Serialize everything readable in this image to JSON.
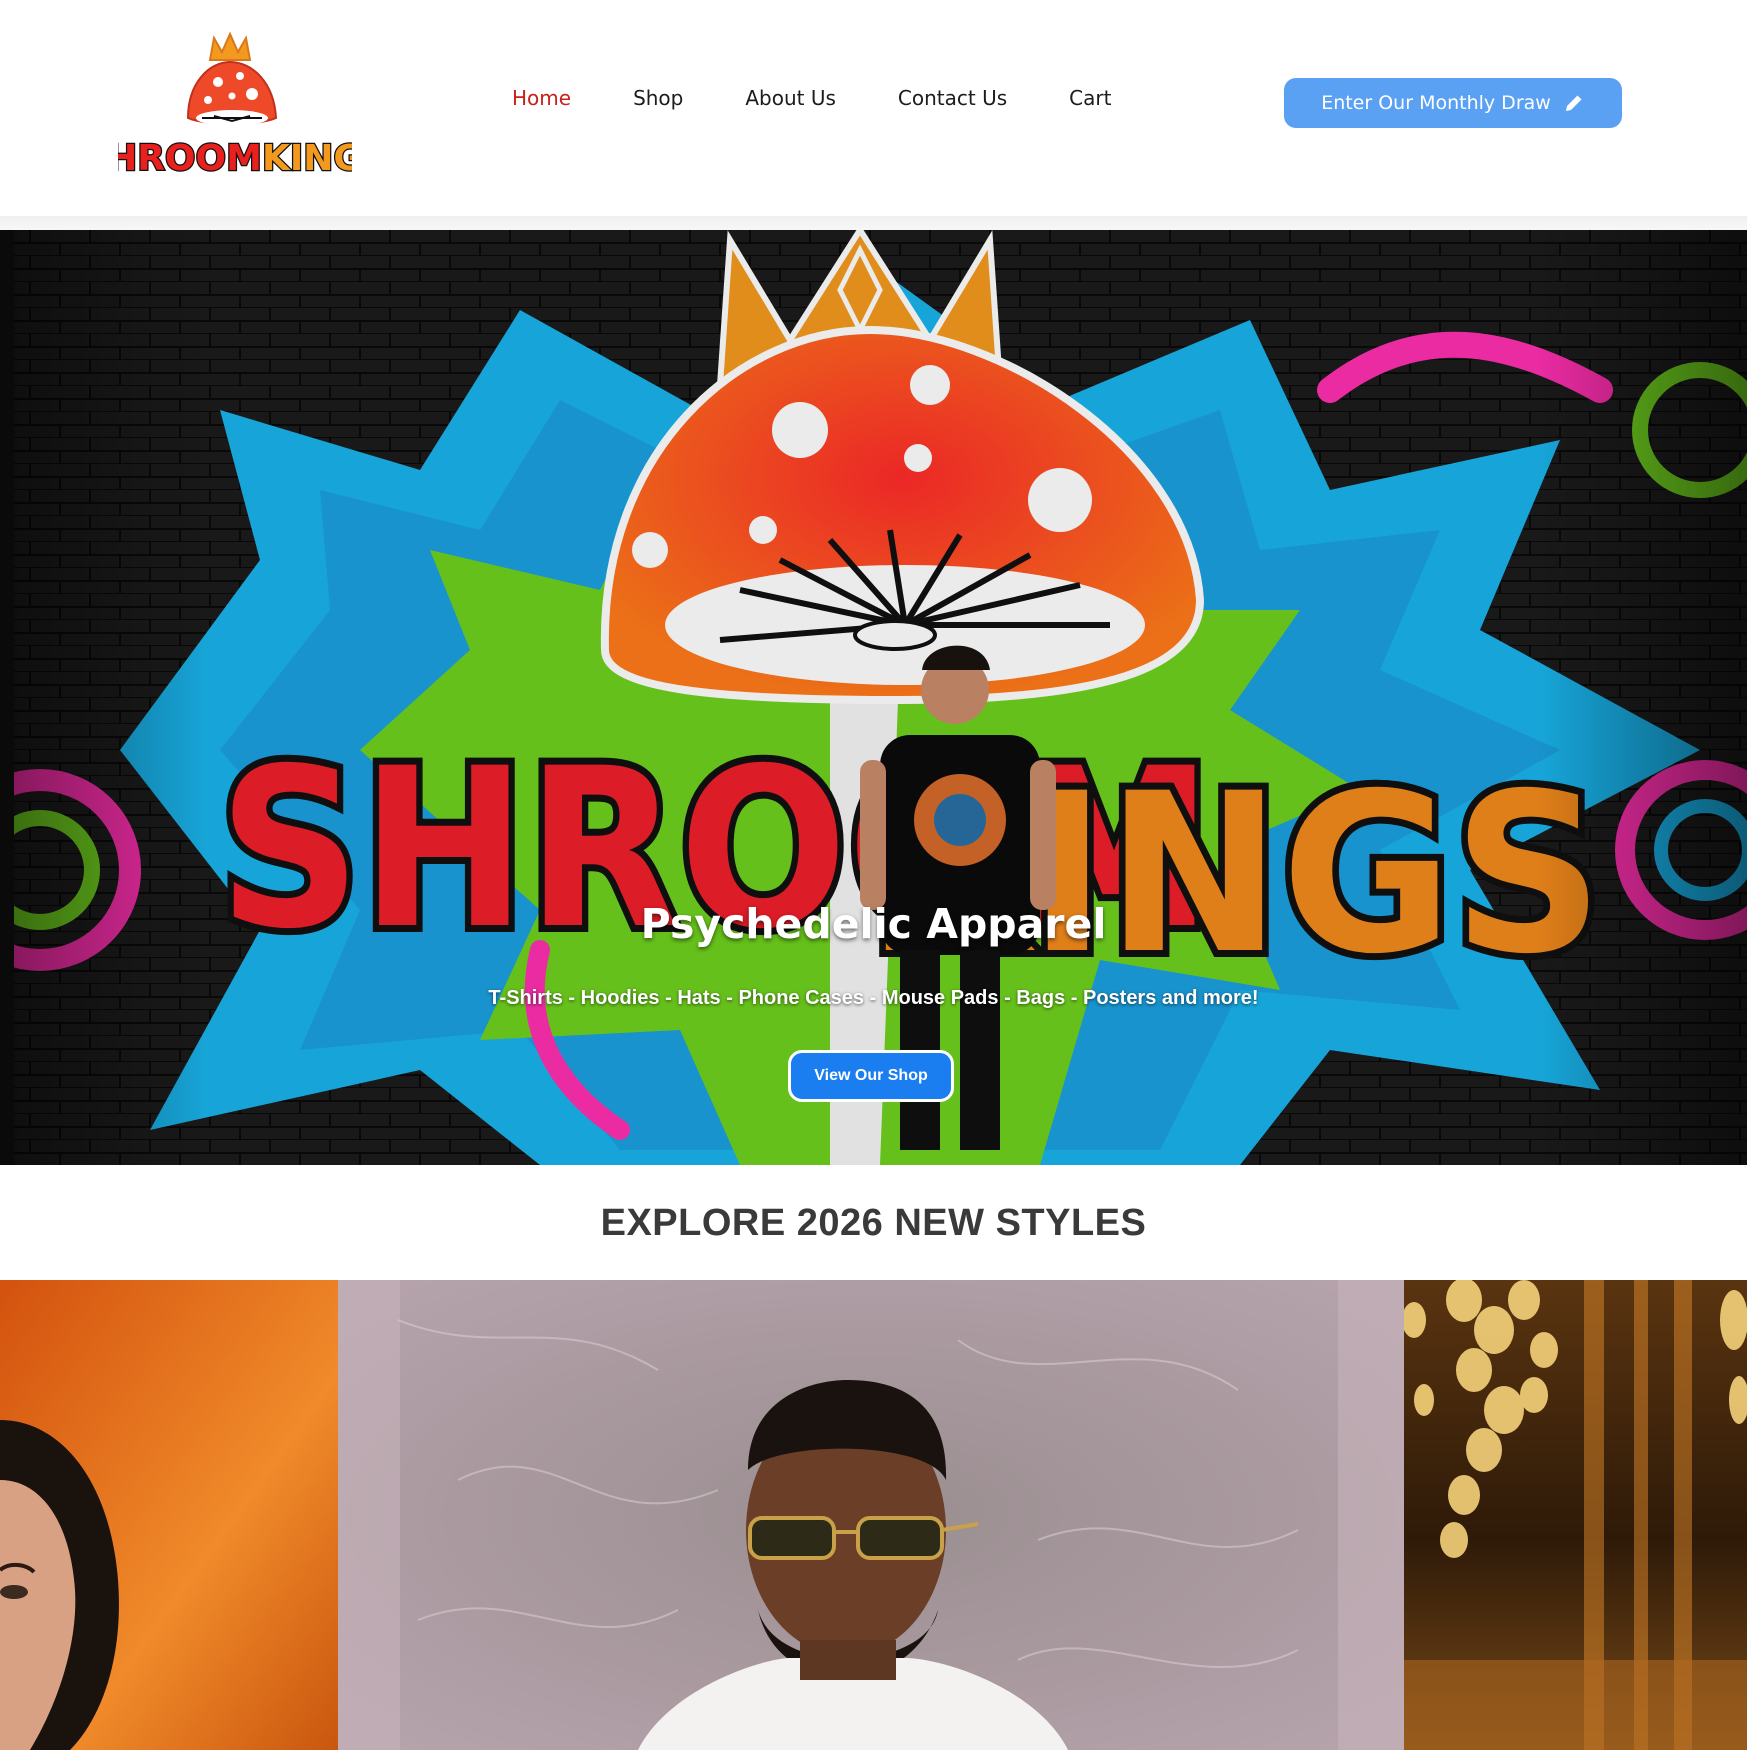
{
  "header": {
    "logo_alt": "ShroomKings",
    "nav": [
      {
        "label": "Home",
        "active": true
      },
      {
        "label": "Shop",
        "active": false
      },
      {
        "label": "About Us",
        "active": false
      },
      {
        "label": "Contact Us",
        "active": false
      },
      {
        "label": "Cart",
        "active": false
      }
    ],
    "draw_button": {
      "label": "Enter Our Monthly Draw",
      "icon": "pencil-icon"
    }
  },
  "hero": {
    "title": "Psychedelic Apparel",
    "subtitle": "T-Shirts - Hoodies - Hats - Phone Cases - Mouse Pads - Bags - Posters and more!",
    "button_label": "View Our Shop"
  },
  "explore": {
    "title": "EXPLORE 2026 NEW STYLES"
  },
  "colors": {
    "nav_active": "#c8201a",
    "draw_button": "#5aa0f3",
    "shop_button": "#1a7df0",
    "heading": "#3a3a3a"
  }
}
